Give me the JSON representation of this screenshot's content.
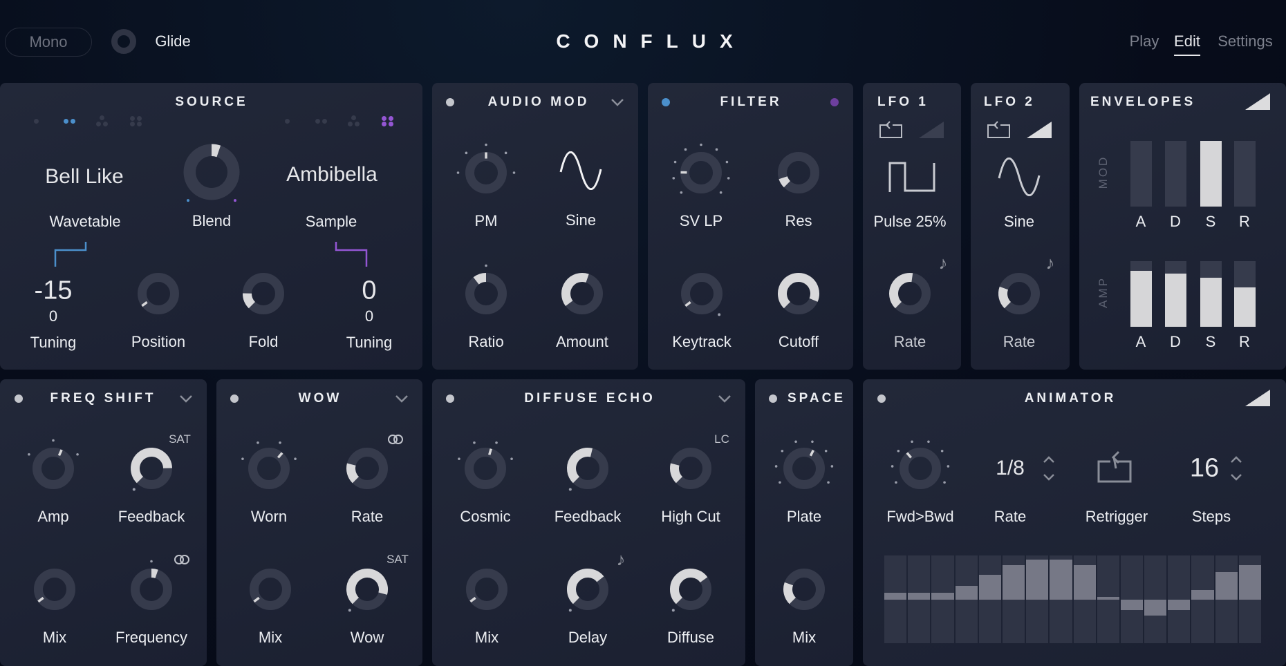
{
  "header": {
    "mono_label": "Mono",
    "glide_label": "Glide",
    "logo": "CONFLUX",
    "tabs": [
      {
        "label": "Play",
        "active": false
      },
      {
        "label": "Edit",
        "active": true
      },
      {
        "label": "Settings",
        "active": false
      }
    ]
  },
  "colors": {
    "accent_blue": "#4b8fcb",
    "accent_purple": "#9456d4",
    "knob_track": "#363b4c",
    "knob_fill": "#d8d8da"
  },
  "source": {
    "title": "SOURCE",
    "left_voices_selected": 2,
    "right_voices_selected": 4,
    "left_name": "Bell Like",
    "left_type": "Wavetable",
    "right_name": "Ambibella",
    "right_type": "Sample",
    "blend": {
      "label": "Blend",
      "value": 0.57,
      "from": 0.5,
      "fill": "arc"
    },
    "left_tuning": {
      "value": "-15",
      "fine": "0",
      "label": "Tuning"
    },
    "right_tuning": {
      "value": "0",
      "fine": "0",
      "label": "Tuning"
    },
    "knobs": [
      {
        "label": "Position",
        "value": 0.03,
        "fill": "pointer"
      },
      {
        "label": "Fold",
        "value": 0.17,
        "fill": "arc"
      }
    ]
  },
  "audio_mod": {
    "title": "AUDIO MOD",
    "wave_label": "Sine",
    "wave_icon": "sine-wave-icon",
    "knobs": [
      {
        "label": "PM",
        "value": 0.5,
        "fill": "pointer",
        "ticks": 5
      },
      {
        "label": "Ratio",
        "value": 0.36,
        "from": 0.5,
        "fill": "arc",
        "ticks": 1
      },
      {
        "label": "Amount",
        "value": 0.57,
        "from": 0.03,
        "fill": "arc"
      }
    ]
  },
  "filter": {
    "title": "FILTER",
    "knobs": [
      {
        "label": "SV LP",
        "value": 0.17,
        "fill": "pointer",
        "ticks": 9
      },
      {
        "label": "Res",
        "value": 0.1,
        "fill": "arc"
      },
      {
        "label": "Keytrack",
        "value": 0.03,
        "fill": "pointer",
        "end_dot": "end"
      },
      {
        "label": "Cutoff",
        "value": 0.92,
        "fill": "arc"
      }
    ]
  },
  "lfo1": {
    "title": "LFO 1",
    "shape": "Pulse 25%",
    "shape_icon": "pulse-wave-icon",
    "ramp_active": false,
    "rate": {
      "label": "Rate",
      "value": 0.53,
      "fill": "arc"
    }
  },
  "lfo2": {
    "title": "LFO 2",
    "shape": "Sine",
    "shape_icon": "sine-wave-icon",
    "ramp_active": true,
    "rate": {
      "label": "Rate",
      "value": 0.24,
      "fill": "arc"
    }
  },
  "envelopes": {
    "title": "ENVELOPES",
    "mod": {
      "label": "MOD",
      "stages": [
        "A",
        "D",
        "S",
        "R"
      ],
      "values": [
        0,
        0,
        1,
        0
      ]
    },
    "amp": {
      "label": "AMP",
      "stages": [
        "A",
        "D",
        "S",
        "R"
      ],
      "values": [
        0.85,
        0.81,
        0.75,
        0.6
      ]
    }
  },
  "freq_shift": {
    "title": "FREQ SHIFT",
    "feedback_tag": "SAT",
    "knobs": [
      {
        "label": "Amp",
        "value": 0.59,
        "fill": "pointer",
        "ticks": 3
      },
      {
        "label": "Feedback",
        "value": 0.83,
        "fill": "arc",
        "end_dot": "start"
      },
      {
        "label": "Mix",
        "value": 0.03,
        "fill": "pointer"
      },
      {
        "label": "Frequency",
        "value": 0.57,
        "from": 0.5,
        "fill": "arc",
        "ticks": 1
      }
    ]
  },
  "wow": {
    "title": "WOW",
    "wow_tag": "SAT",
    "knobs": [
      {
        "label": "Worn",
        "value": 0.65,
        "fill": "pointer",
        "ticks": 4
      },
      {
        "label": "Rate",
        "value": 0.22,
        "fill": "arc"
      },
      {
        "label": "Mix",
        "value": 0.03,
        "fill": "pointer"
      },
      {
        "label": "Wow",
        "value": 0.89,
        "fill": "arc",
        "end_dot": "start"
      }
    ]
  },
  "diffuse_echo": {
    "title": "DIFFUSE ECHO",
    "high_cut_tag": "LC",
    "knobs": [
      {
        "label": "Cosmic",
        "value": 0.56,
        "fill": "pointer",
        "ticks": 4
      },
      {
        "label": "Feedback",
        "value": 0.55,
        "fill": "arc",
        "end_dot": "start"
      },
      {
        "label": "High Cut",
        "value": 0.22,
        "fill": "arc"
      },
      {
        "label": "Mix",
        "value": 0.03,
        "fill": "pointer"
      },
      {
        "label": "Delay",
        "value": 0.69,
        "fill": "arc",
        "end_dot": "start"
      },
      {
        "label": "Diffuse",
        "value": 0.7,
        "fill": "arc",
        "end_dot": "start"
      }
    ]
  },
  "space": {
    "title": "SPACE",
    "knobs": [
      {
        "label": "Plate",
        "value": 0.6,
        "fill": "pointer",
        "ticks": 8
      },
      {
        "label": "Mix",
        "value": 0.24,
        "fill": "arc"
      }
    ]
  },
  "animator": {
    "title": "ANIMATOR",
    "direction": {
      "label": "Fwd>Bwd",
      "value": 0.35,
      "fill": "pointer",
      "ticks": 8
    },
    "rate_value": "1/8",
    "rate_label": "Rate",
    "retrigger_label": "Retrigger",
    "steps_value": "16",
    "steps_label": "Steps",
    "step_values": [
      0.16,
      0.16,
      0.16,
      0.31,
      0.56,
      0.78,
      0.91,
      0.91,
      0.78,
      0.07,
      -0.24,
      -0.36,
      -0.24,
      0.22,
      0.62,
      0.78
    ]
  }
}
